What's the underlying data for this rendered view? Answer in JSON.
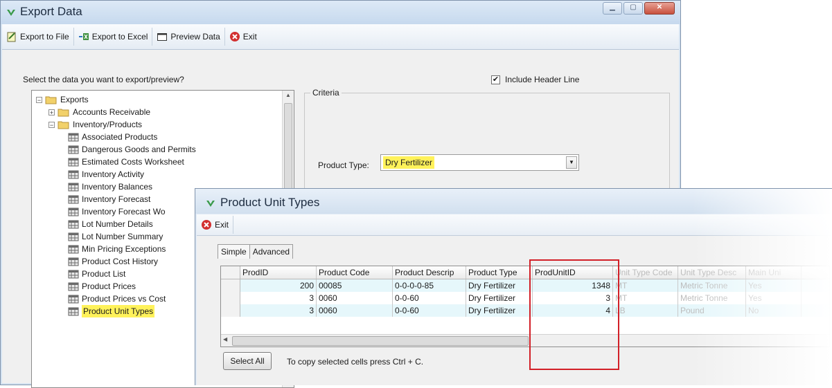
{
  "main_window": {
    "title": "Export Data",
    "toolbar": {
      "export_file": "Export to File",
      "export_excel": "Export to Excel",
      "preview": "Preview Data",
      "exit": "Exit"
    },
    "prompt": "Select the data you want to export/preview?",
    "include_header_label": "Include Header Line",
    "include_header_checked": true,
    "tree": {
      "root": "Exports",
      "groups": [
        "Accounts Receivable",
        "Inventory/Products"
      ],
      "items": [
        "Associated Products",
        "Dangerous Goods and Permits",
        "Estimated Costs Worksheet",
        "Inventory Activity",
        "Inventory Balances",
        "Inventory Forecast",
        "Inventory Forecast Wo",
        "Lot Number Details",
        "Lot Number Summary",
        "Min Pricing Exceptions",
        "Product Cost History",
        "Product List",
        "Product Prices",
        "Product Prices vs Cost",
        "Product Unit Types"
      ],
      "selected_item": "Product Unit Types"
    },
    "criteria_label": "Criteria",
    "product_type_label": "Product Type:",
    "product_type_value": "Dry Fertilizer"
  },
  "child_window": {
    "title": "Product Unit Types",
    "exit": "Exit",
    "tabs": [
      "Simple",
      "Advanced"
    ],
    "columns": [
      "ProdID",
      "Product Code",
      "Product Descrip",
      "Product Type",
      "ProdUnitID",
      "Unit Type Code",
      "Unit Type Desc",
      "Main Uni"
    ],
    "rows": [
      [
        "200",
        "00085",
        "0-0-0-0-85",
        "Dry Fertilizer",
        "1348",
        "MT",
        "Metric Tonne",
        "Yes"
      ],
      [
        "3",
        "0060",
        "0-0-60",
        "Dry Fertilizer",
        "3",
        "MT",
        "Metric Tonne",
        "Yes"
      ],
      [
        "3",
        "0060",
        "0-0-60",
        "Dry Fertilizer",
        "4",
        "LB",
        "Pound",
        "No"
      ]
    ],
    "select_all": "Select All",
    "copy_hint": "To copy selected cells press Ctrl + C."
  },
  "colors": {
    "highlight": "#fff25a",
    "callout_box": "#d21f27",
    "alt_row": "#e6f7fb"
  }
}
